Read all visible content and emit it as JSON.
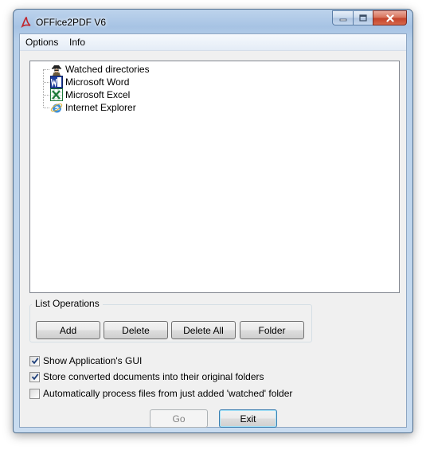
{
  "window": {
    "title": "OFFice2PDF V6",
    "accent": "#c4432b"
  },
  "menu": [
    {
      "label": "Options"
    },
    {
      "label": "Info"
    }
  ],
  "tree": {
    "items": [
      {
        "label": "Watched directories",
        "icon": "detective-icon"
      },
      {
        "label": "Microsoft Word",
        "icon": "word-icon"
      },
      {
        "label": "Microsoft Excel",
        "icon": "excel-icon"
      },
      {
        "label": "Internet Explorer",
        "icon": "ie-icon"
      }
    ]
  },
  "list_operations": {
    "title": "List Operations",
    "buttons": {
      "add": "Add",
      "delete": "Delete",
      "delete_all": "Delete All",
      "folder": "Folder"
    }
  },
  "options": [
    {
      "label": "Show Application's GUI",
      "checked": true
    },
    {
      "label": "Store converted documents into their original folders",
      "checked": true
    },
    {
      "label": "Automatically process files from just added 'watched' folder",
      "checked": false
    }
  ],
  "actions": {
    "go": "Go",
    "exit": "Exit"
  }
}
